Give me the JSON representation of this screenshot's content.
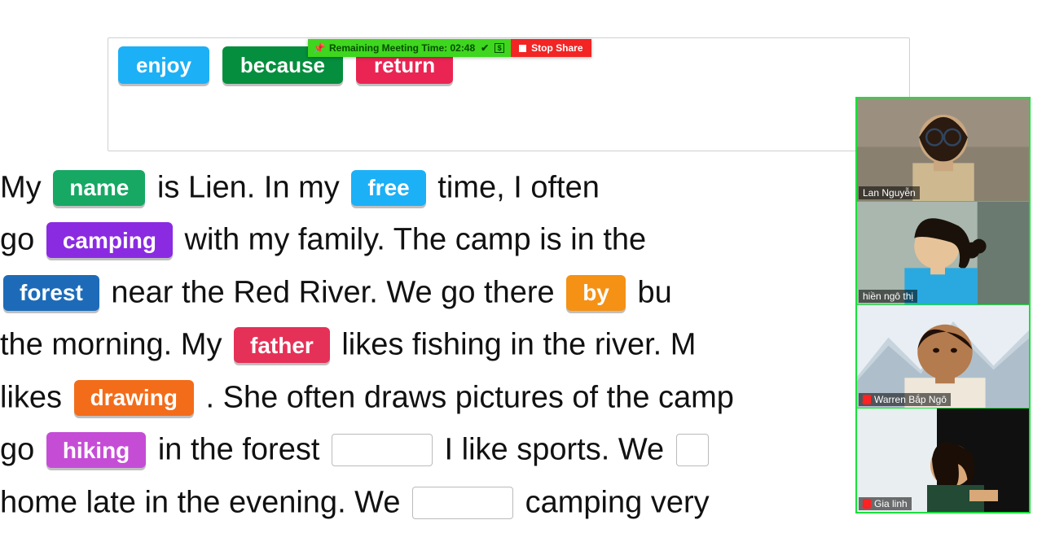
{
  "word_bank": {
    "items": [
      {
        "label": "enjoy",
        "cls": "chip-blue"
      },
      {
        "label": "because",
        "cls": "chip-green2"
      },
      {
        "label": "return",
        "cls": "chip-red"
      }
    ]
  },
  "story": {
    "t1": "My ",
    "t2": " is Lien. In my ",
    "t3": " time, I often",
    "t4": "go ",
    "t5": " with my family. The camp is in the",
    "t6": " near the Red River. We go there ",
    "t7": " bu",
    "t8": "the morning. My ",
    "t9": " likes fishing in the river. M",
    "t10": "likes ",
    "t11": ". She often draws pictures of the camp",
    "t12": "go ",
    "t13": " in the forest ",
    "t14": " I like sports. We ",
    "t15": "home late in the evening. We ",
    "t16": " camping very"
  },
  "tags": {
    "name": "name",
    "free": "free",
    "camping": "camping",
    "forest": "forest",
    "by": "by",
    "father": "father",
    "drawing": "drawing",
    "hiking": "hiking"
  },
  "zoom_bar": {
    "time_label": "Remaining Meeting Time: 02:48",
    "stop_label": "Stop Share"
  },
  "participants": [
    {
      "name": "Lan Nguyễn",
      "muted": false
    },
    {
      "name": "hiền ngô thị",
      "muted": false
    },
    {
      "name": "Warren Bắp Ngô",
      "muted": true
    },
    {
      "name": "Gia linh",
      "muted": true
    }
  ]
}
